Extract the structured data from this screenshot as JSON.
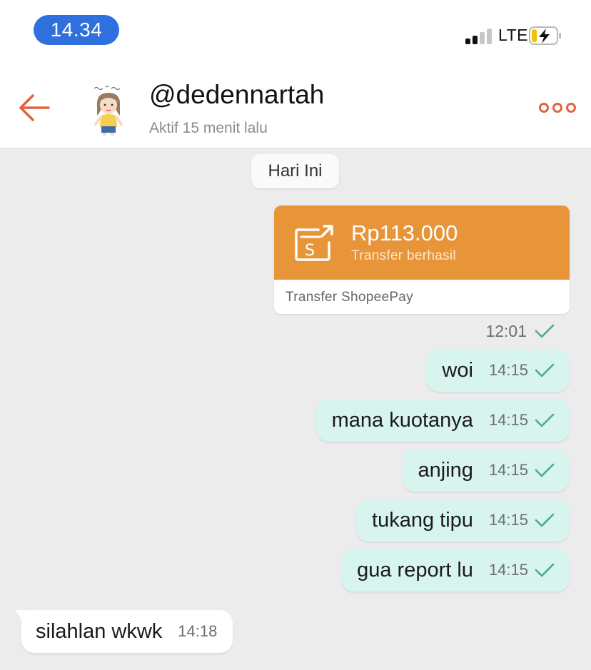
{
  "status_bar": {
    "time": "14.34",
    "network": "LTE",
    "icons": [
      "signal-bars-icon",
      "battery-charging-icon"
    ]
  },
  "header": {
    "username": "@dedennartah",
    "presence": "Aktif 15 menit lalu",
    "icons": [
      "back-arrow-icon",
      "avatar-illustration",
      "more-dots-icon"
    ]
  },
  "chat": {
    "date_label": "Hari Ini",
    "transfer": {
      "amount": "Rp113.000",
      "status": "Transfer berhasil",
      "method": "Transfer ShopeePay",
      "time": "12:01",
      "icon": "shopeepay-transfer-icon"
    },
    "messages": [
      {
        "text": "woi",
        "time": "14:15",
        "direction": "outgoing",
        "read": true
      },
      {
        "text": "mana kuotanya",
        "time": "14:15",
        "direction": "outgoing",
        "read": true
      },
      {
        "text": "anjing",
        "time": "14:15",
        "direction": "outgoing",
        "read": true
      },
      {
        "text": "tukang tipu",
        "time": "14:15",
        "direction": "outgoing",
        "read": true
      },
      {
        "text": "gua report lu",
        "time": "14:15",
        "direction": "outgoing",
        "read": true
      },
      {
        "text": "silahlan wkwk",
        "time": "14:18",
        "direction": "incoming",
        "read": false
      }
    ]
  },
  "colors": {
    "accent": "#e0643d",
    "transfer_orange": "#e8953a",
    "outgoing_bubble": "#d8f4ef",
    "incoming_bubble": "#ffffff",
    "check_teal": "#4fa893",
    "time_pill": "#2f6fde",
    "chat_background": "#ececec"
  }
}
